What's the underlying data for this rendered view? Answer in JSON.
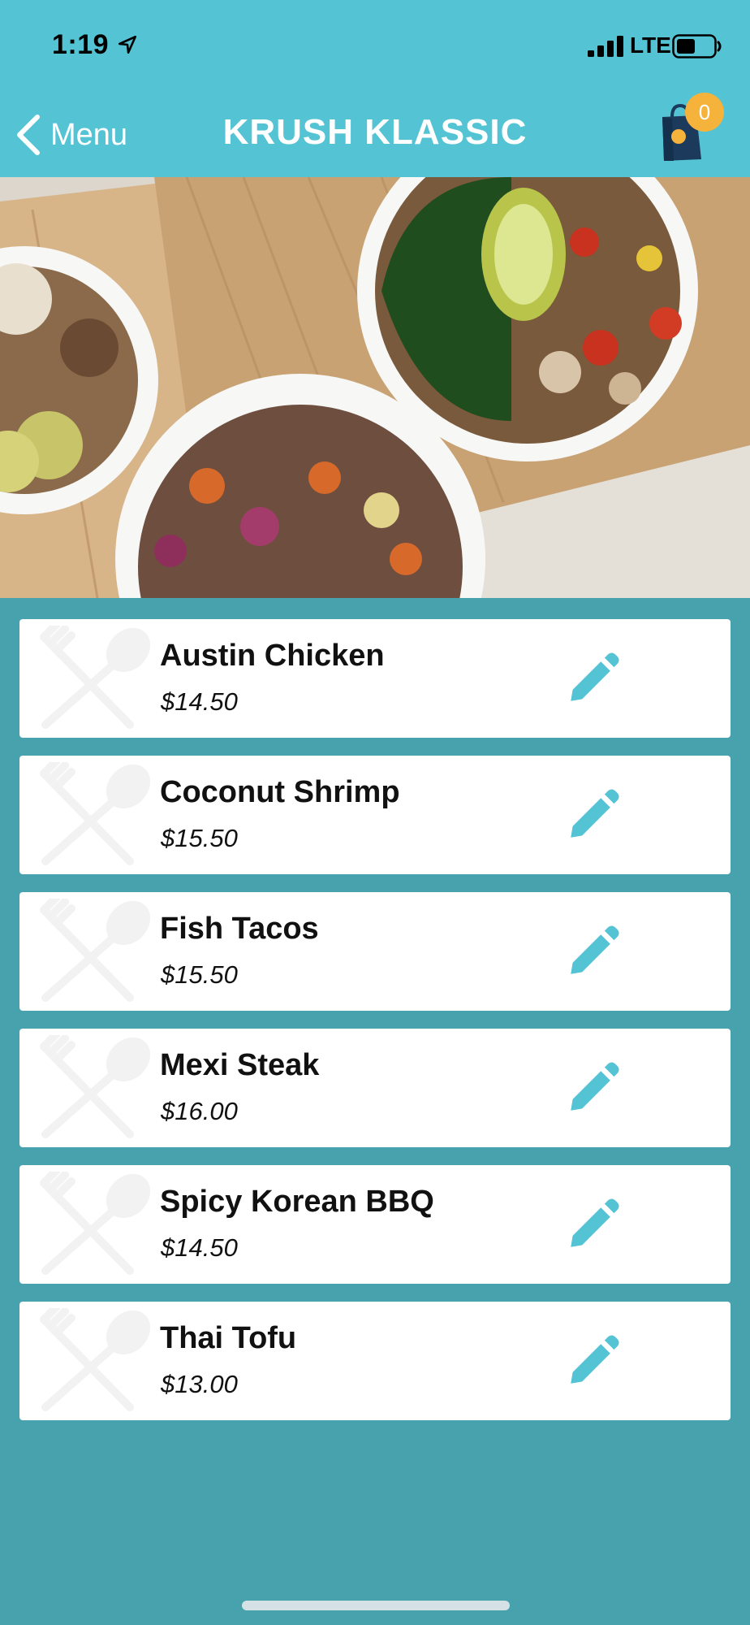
{
  "status_bar": {
    "time": "1:19",
    "network": "LTE"
  },
  "nav": {
    "back_label": "Menu",
    "title": "KRUSH KLASSIC",
    "cart_count": "0"
  },
  "items": [
    {
      "name": "Austin Chicken",
      "price": "$14.50"
    },
    {
      "name": "Coconut Shrimp",
      "price": "$15.50"
    },
    {
      "name": "Fish Tacos",
      "price": "$15.50"
    },
    {
      "name": "Mexi Steak",
      "price": "$16.00"
    },
    {
      "name": "Spicy Korean BBQ",
      "price": "$14.50"
    },
    {
      "name": "Thai Tofu",
      "price": "$13.00"
    }
  ],
  "colors": {
    "header": "#54c3d4",
    "background": "#48a2ae",
    "accent": "#54c3d4",
    "badge": "#f6b33c"
  },
  "icons": [
    "location-arrow-icon",
    "signal-icon",
    "battery-icon",
    "chevron-left-icon",
    "shopping-bag-icon",
    "utensils-icon",
    "pencil-icon"
  ]
}
